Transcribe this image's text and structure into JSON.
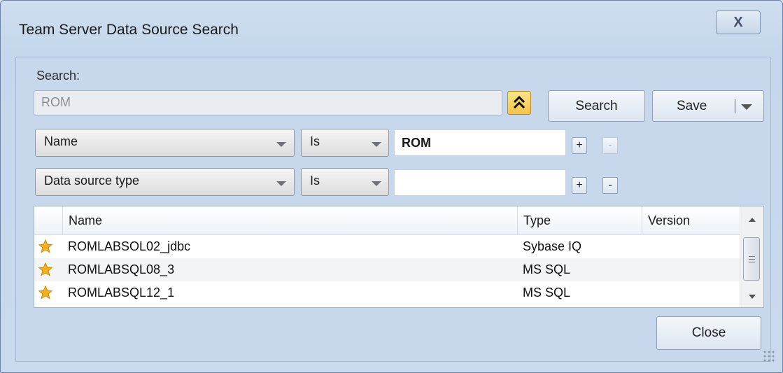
{
  "window": {
    "title": "Team Server Data Source Search",
    "close_glyph": "X"
  },
  "search": {
    "label": "Search:",
    "value": "ROM",
    "collapse_icon": "double-chevron-up-icon",
    "search_button": "Search",
    "save_button": "Save"
  },
  "filters": [
    {
      "field": "Name",
      "operator": "Is",
      "value": "ROM",
      "add": "+",
      "remove": "-",
      "remove_enabled": false
    },
    {
      "field": "Data source type",
      "operator": "Is",
      "value": "",
      "add": "+",
      "remove": "-",
      "remove_enabled": true
    }
  ],
  "grid": {
    "columns": [
      "Name",
      "Type",
      "Version"
    ],
    "rows": [
      {
        "favorite": true,
        "name": "ROMLABSOL02_jdbc",
        "type": "Sybase IQ",
        "version": ""
      },
      {
        "favorite": true,
        "name": "ROMLABSQL08_3",
        "type": "MS SQL",
        "version": ""
      },
      {
        "favorite": true,
        "name": "ROMLABSQL12_1",
        "type": "MS SQL",
        "version": ""
      }
    ]
  },
  "footer": {
    "close_button": "Close"
  },
  "colors": {
    "star": "#f2b01e",
    "collapse_button": "#f3c34a"
  }
}
